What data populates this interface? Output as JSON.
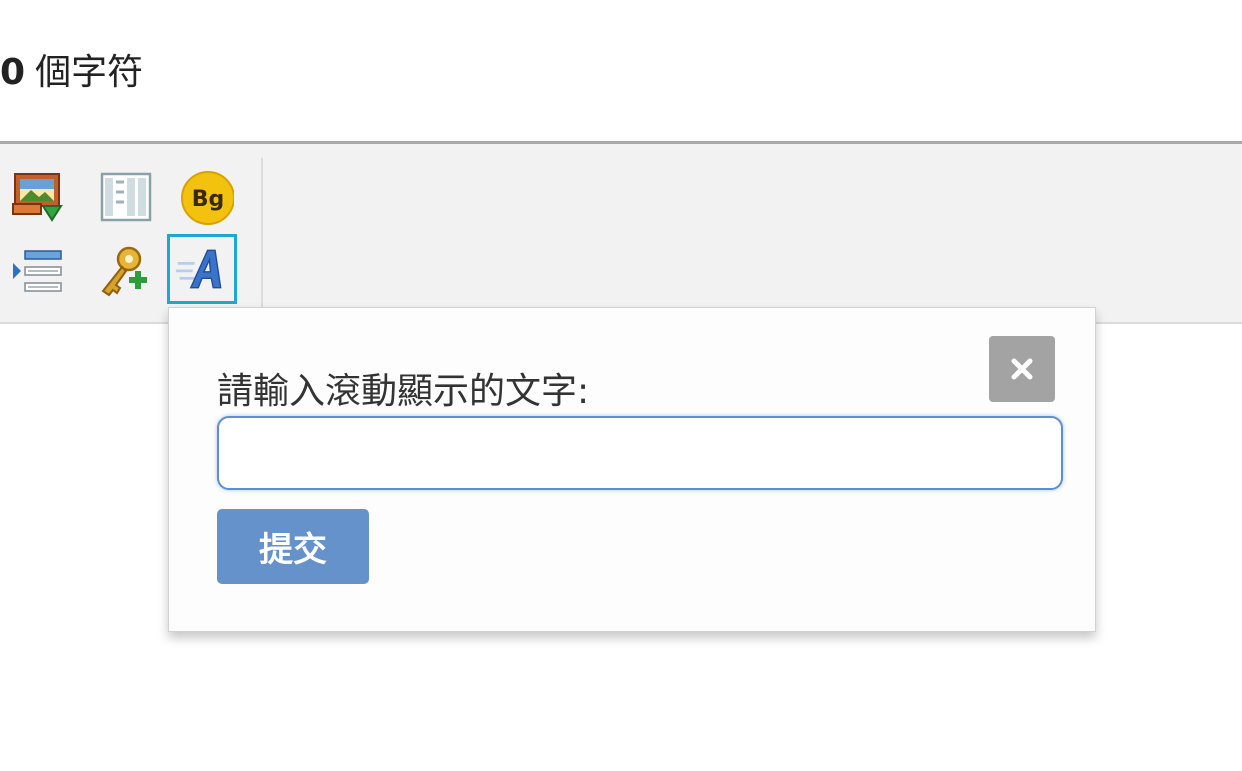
{
  "status": {
    "char_count": "0",
    "char_unit": "個字符"
  },
  "toolbar": {
    "items": [
      {
        "icon": "insert-image-icon",
        "selected": false
      },
      {
        "icon": "table-columns-icon",
        "selected": false
      },
      {
        "icon": "bg-color-icon",
        "badge_text": "Bg",
        "selected": false
      },
      {
        "icon": "indent-list-icon",
        "selected": false
      },
      {
        "icon": "key-add-icon",
        "selected": false
      },
      {
        "icon": "marquee-text-icon",
        "selected": true
      }
    ]
  },
  "dialog": {
    "prompt_label": "請輸入滾動顯示的文字:",
    "input_value": "",
    "input_placeholder": "",
    "submit_label": "提交",
    "close_icon": "close-icon"
  },
  "colors": {
    "toolbar_bg": "#f2f2f2",
    "selected_border": "#20a7cf",
    "submit_bg": "#6592ca",
    "close_bg": "#a3a3a3",
    "input_border": "#5f8ed0"
  }
}
